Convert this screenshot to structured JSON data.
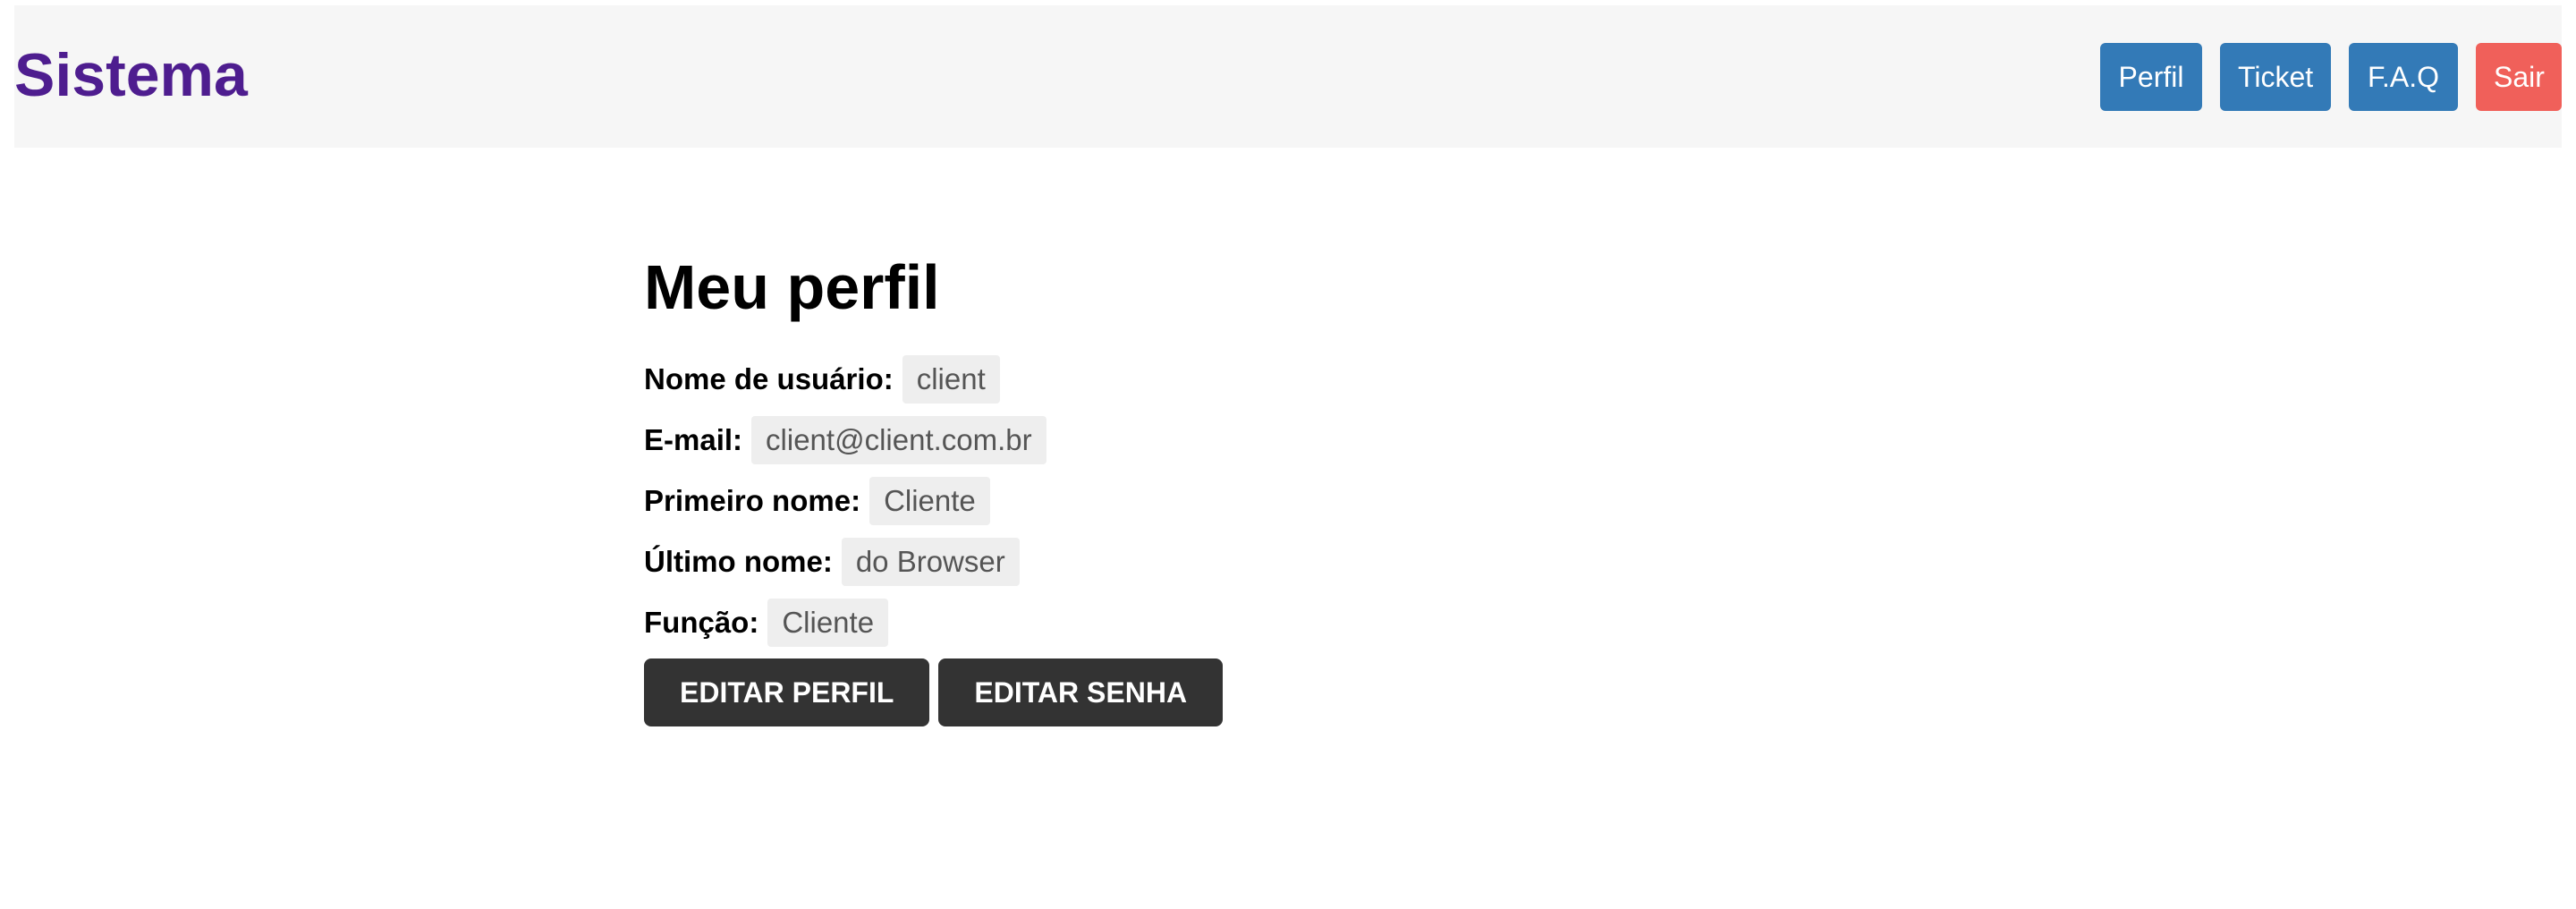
{
  "header": {
    "brand": "Sistema",
    "nav": [
      {
        "label": "Perfil"
      },
      {
        "label": "Ticket"
      },
      {
        "label": "F.A.Q"
      },
      {
        "label": "Sair"
      }
    ]
  },
  "profile": {
    "title": "Meu perfil",
    "fields": [
      {
        "label": "Nome de usuário:",
        "value": "client"
      },
      {
        "label": "E-mail:",
        "value": "client@client.com.br"
      },
      {
        "label": "Primeiro nome:",
        "value": "Cliente"
      },
      {
        "label": "Último nome:",
        "value": "do Browser"
      },
      {
        "label": "Função:",
        "value": "Cliente"
      }
    ],
    "actions": {
      "edit_profile": "EDITAR PERFIL",
      "edit_password": "EDITAR SENHA"
    }
  },
  "colors": {
    "brand": "#4e1d8f",
    "nav_primary": "#337ab7",
    "nav_danger": "#f0605a",
    "navbar_bg": "#f6f6f6",
    "action_bg": "#333333"
  }
}
